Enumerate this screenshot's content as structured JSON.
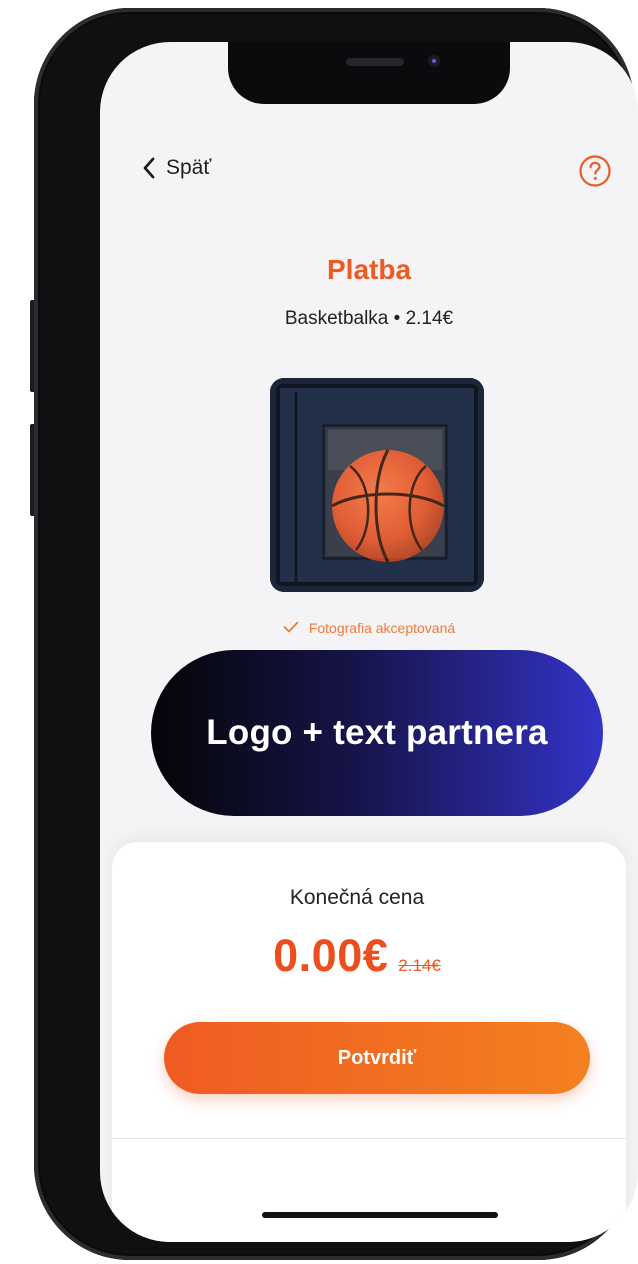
{
  "nav": {
    "back_label": "Späť",
    "back_icon": "chevron-left-icon",
    "help_icon": "question-circle-icon"
  },
  "header": {
    "title": "Platba",
    "subtitle": "Basketbalka • 2.14€"
  },
  "photo": {
    "status_icon": "check-icon",
    "status_text": "Fotografia akceptovaná"
  },
  "partner": {
    "text": "Logo + text partnera"
  },
  "summary": {
    "label": "Konečná cena",
    "final_price": "0.00€",
    "original_price": "2.14€"
  },
  "actions": {
    "confirm_label": "Potvrdiť"
  },
  "colors": {
    "accent": "#ee5a24",
    "banner_start": "#050508",
    "banner_end": "#3333c8"
  }
}
